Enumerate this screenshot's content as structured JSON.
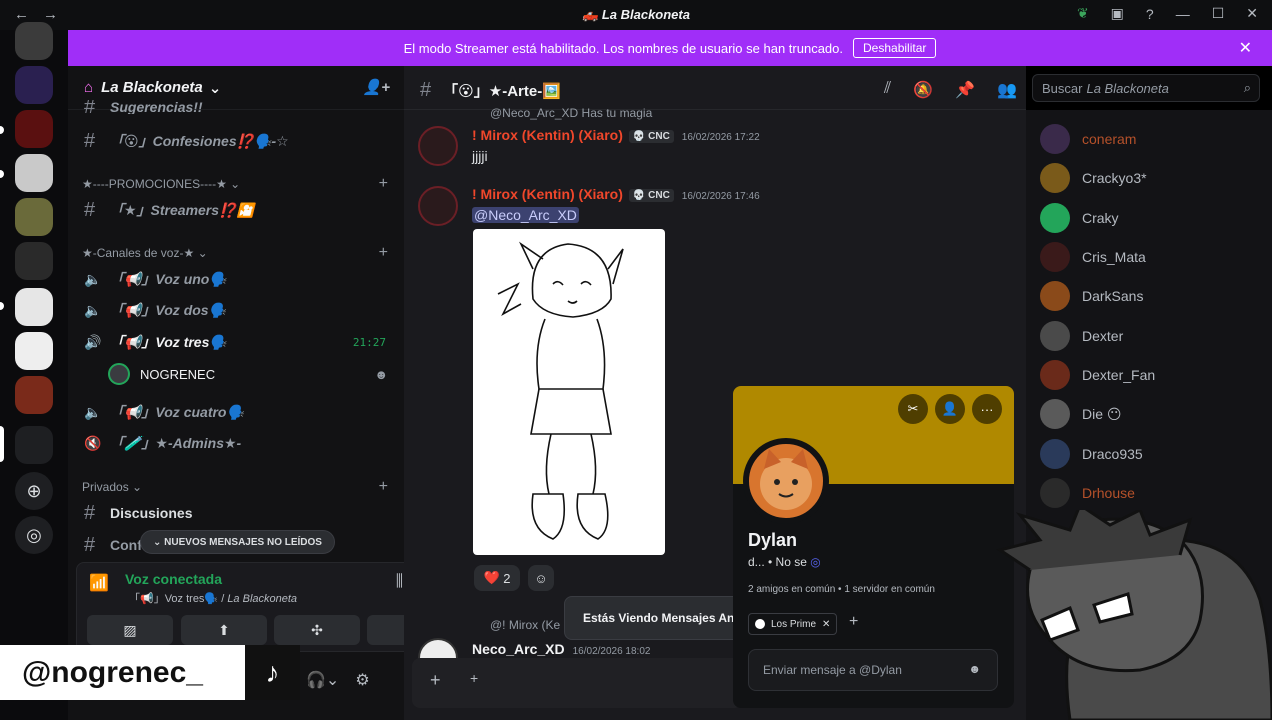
{
  "window": {
    "title": "La Blackoneta",
    "back": "←",
    "forward": "→",
    "min": "—",
    "max": "☐",
    "close": "✕",
    "help": "?",
    "inbox": "▣",
    "leaf": "❦"
  },
  "banner": {
    "text": "El modo Streamer está habilitado. Los nombres de usuario se han truncado.",
    "button": "Deshabilitar",
    "close": "✕"
  },
  "server": {
    "name": "La Blackoneta",
    "chevron": "⌄"
  },
  "channels": [
    {
      "label": "Sugerencias!!",
      "icon": "#"
    },
    {
      "label": "「😮」Confesiones⁉️🗣️-☆",
      "icon": "#"
    },
    {
      "label": "「★」Streamers⁉️🎦",
      "icon": "#"
    }
  ],
  "categories": {
    "promo": "★----PROMOCIONES----★",
    "voice": "★-Canales de voz-★",
    "private": "Privados"
  },
  "voice_channels": [
    {
      "label": "「📢」Voz uno🗣️"
    },
    {
      "label": "「📢」Voz dos🗣️"
    },
    {
      "label": "「📢」Voz tres🗣️",
      "time": "21:27"
    },
    {
      "label": "「📢」Voz cuatro🗣️"
    },
    {
      "label": "「🧪」★-Admins★-"
    }
  ],
  "voice_user": {
    "name": "NOGRENEC",
    "emoji": "☻"
  },
  "private_channels": [
    {
      "label": "Discusiones"
    },
    {
      "label": "Conf"
    }
  ],
  "new_messages_pill": "NUEVOS MENSAJES NO LEÍDOS",
  "voice_panel": {
    "status": "Voz conectada",
    "channel": "「📢」Voz tres🗣️",
    "server": "La Blackoneta"
  },
  "watermark": {
    "handle": "@nogrenec_",
    "tiktok": "♪"
  },
  "chat": {
    "channel_title": "「😮」★-Arte-🖼️",
    "search_prefix": "Buscar",
    "search_server": "La Blackoneta",
    "reply1": "@Neco_Arc_XD Has tu magia",
    "msg1": {
      "author": "! Mirox (Kentin) (Xiaro)",
      "tag": "💀 CNC",
      "time": "16/02/2026 17:22",
      "text": "jjjji"
    },
    "msg2": {
      "author": "! Mirox (Kentin) (Xiaro)",
      "tag": "💀 CNC",
      "time": "16/02/2026 17:46",
      "mention": "@Neco_Arc_XD"
    },
    "reactions": {
      "heart": "❤️",
      "count": "2",
      "add": "☺"
    },
    "reply2": "@! Mirox (Ke",
    "msg3": {
      "author": "Neco_Arc_XD",
      "time": "16/02/2026 18:02"
    },
    "toast": "Estás Viendo Mensajes Antiguos",
    "composer_plus": "+"
  },
  "members": [
    {
      "name": "coneram",
      "color": "#b5512a"
    },
    {
      "name": "Crackyo3*"
    },
    {
      "name": "Craky"
    },
    {
      "name": "Cris_Mata"
    },
    {
      "name": "DarkSans"
    },
    {
      "name": "Dexter"
    },
    {
      "name": "Dexter_Fan"
    },
    {
      "name": "Die 😶"
    },
    {
      "name": "Draco935"
    },
    {
      "name": "Drhouse",
      "color": "#b5512a"
    }
  ],
  "profile": {
    "name": "Dylan",
    "status": "d... • No se",
    "mutual": "2 amigos en común  •  1 servidor en común",
    "role": "Los Prime",
    "role_remove": "✕",
    "add_role": "+",
    "input_placeholder": "Enviar mensaje a @Dylan",
    "more": "···"
  }
}
